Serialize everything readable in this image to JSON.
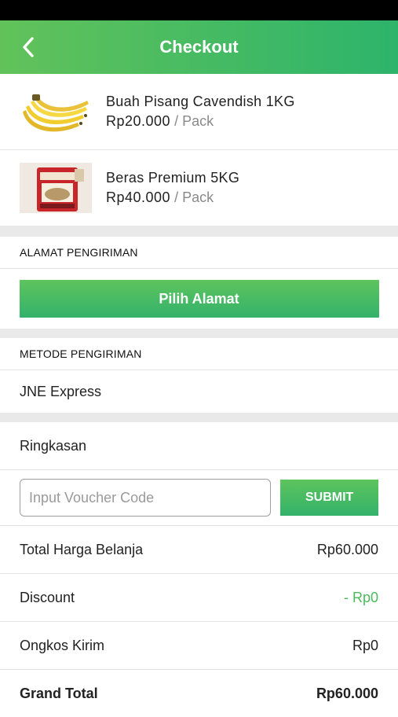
{
  "header": {
    "title": "Checkout",
    "back_icon": "chevron-left-icon"
  },
  "products": [
    {
      "name": "Buah Pisang Cavendish 1KG",
      "price": "Rp20.000",
      "unit": "/ Pack",
      "image": "banana-image"
    },
    {
      "name": "Beras Premium 5KG",
      "price": "Rp40.000",
      "unit": "/ Pack",
      "image": "rice-bag-image"
    }
  ],
  "shipping_address": {
    "heading": "ALAMAT PENGIRIMAN",
    "button_label": "Pilih Alamat"
  },
  "shipping_method": {
    "heading": "METODE PENGIRIMAN",
    "value": "JNE Express"
  },
  "summary": {
    "heading": "Ringkasan",
    "voucher_placeholder": "Input Voucher Code",
    "submit_label": "SUBMIT",
    "total_label": "Total Harga Belanja",
    "total_value": "Rp60.000",
    "discount_label": "Discount",
    "discount_value": "- Rp0",
    "shipping_label": "Ongkos Kirim",
    "shipping_value": "Rp0",
    "grand_label": "Grand Total",
    "grand_value": "Rp60.000"
  },
  "colors": {
    "accent": "#3bb56a",
    "discount": "#4cb95d"
  }
}
